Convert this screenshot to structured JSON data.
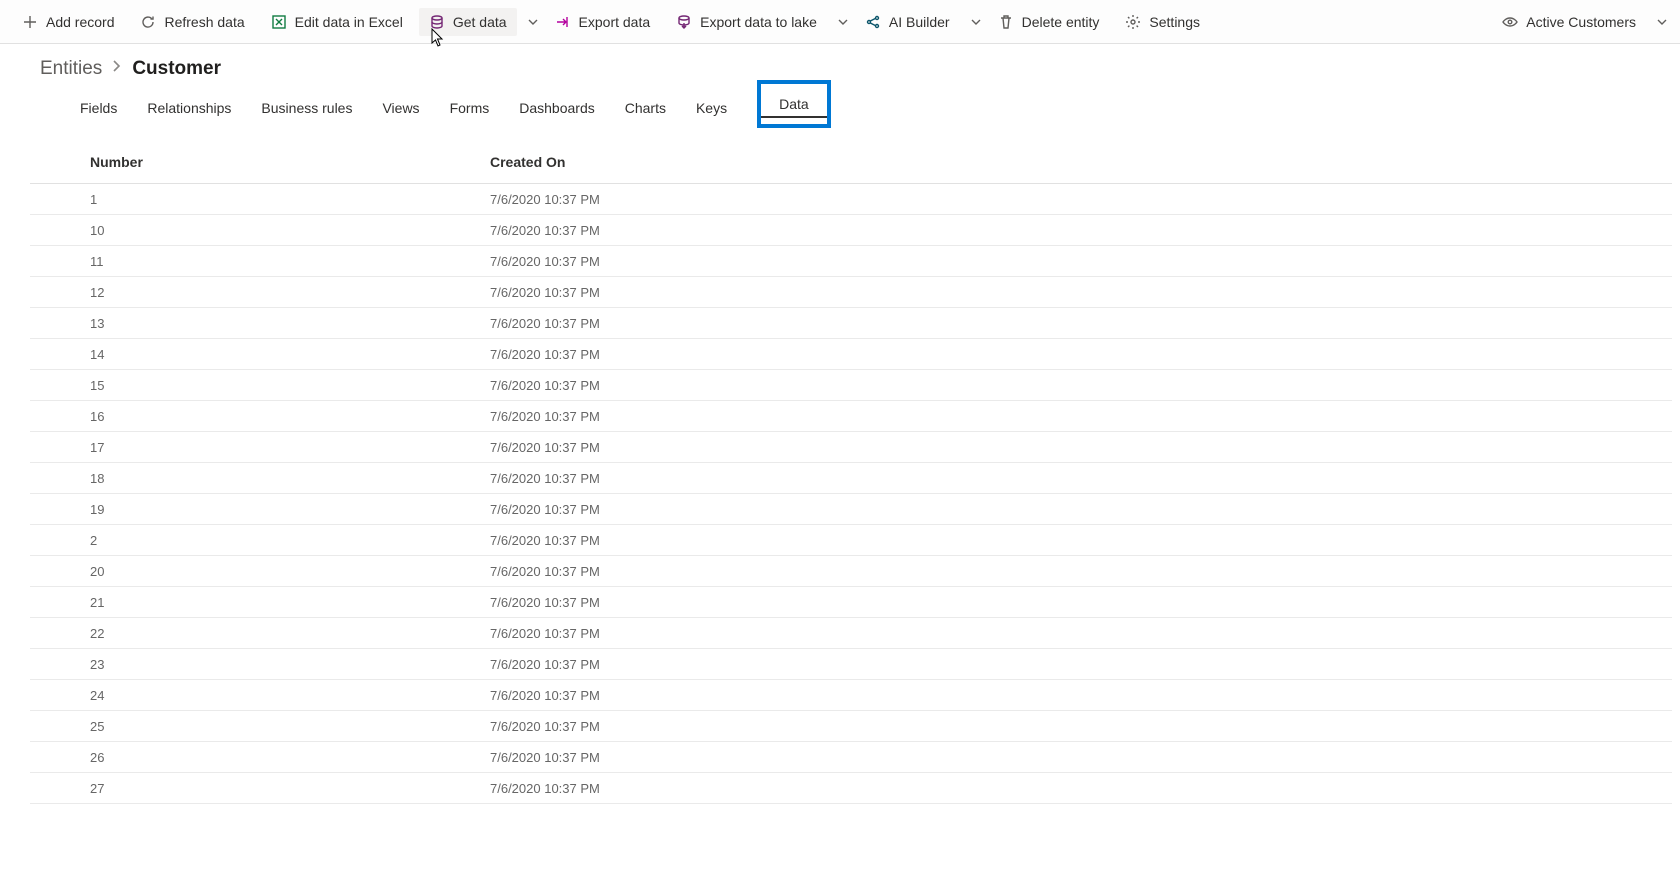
{
  "toolbar": {
    "add_record": "Add record",
    "refresh_data": "Refresh data",
    "edit_excel": "Edit data in Excel",
    "get_data": "Get data",
    "export_data": "Export data",
    "export_lake": "Export data to lake",
    "ai_builder": "AI Builder",
    "delete_entity": "Delete entity",
    "settings": "Settings",
    "active_view": "Active Customers"
  },
  "breadcrumb": {
    "root": "Entities",
    "current": "Customer"
  },
  "tabs": {
    "fields": "Fields",
    "relationships": "Relationships",
    "business_rules": "Business rules",
    "views": "Views",
    "forms": "Forms",
    "dashboards": "Dashboards",
    "charts": "Charts",
    "keys": "Keys",
    "data": "Data"
  },
  "columns": {
    "number": "Number",
    "created_on": "Created On"
  },
  "rows": [
    {
      "number": "1",
      "created_on": "7/6/2020 10:37 PM"
    },
    {
      "number": "10",
      "created_on": "7/6/2020 10:37 PM"
    },
    {
      "number": "11",
      "created_on": "7/6/2020 10:37 PM"
    },
    {
      "number": "12",
      "created_on": "7/6/2020 10:37 PM"
    },
    {
      "number": "13",
      "created_on": "7/6/2020 10:37 PM"
    },
    {
      "number": "14",
      "created_on": "7/6/2020 10:37 PM"
    },
    {
      "number": "15",
      "created_on": "7/6/2020 10:37 PM"
    },
    {
      "number": "16",
      "created_on": "7/6/2020 10:37 PM"
    },
    {
      "number": "17",
      "created_on": "7/6/2020 10:37 PM"
    },
    {
      "number": "18",
      "created_on": "7/6/2020 10:37 PM"
    },
    {
      "number": "19",
      "created_on": "7/6/2020 10:37 PM"
    },
    {
      "number": "2",
      "created_on": "7/6/2020 10:37 PM"
    },
    {
      "number": "20",
      "created_on": "7/6/2020 10:37 PM"
    },
    {
      "number": "21",
      "created_on": "7/6/2020 10:37 PM"
    },
    {
      "number": "22",
      "created_on": "7/6/2020 10:37 PM"
    },
    {
      "number": "23",
      "created_on": "7/6/2020 10:37 PM"
    },
    {
      "number": "24",
      "created_on": "7/6/2020 10:37 PM"
    },
    {
      "number": "25",
      "created_on": "7/6/2020 10:37 PM"
    },
    {
      "number": "26",
      "created_on": "7/6/2020 10:37 PM"
    },
    {
      "number": "27",
      "created_on": "7/6/2020 10:37 PM"
    }
  ]
}
